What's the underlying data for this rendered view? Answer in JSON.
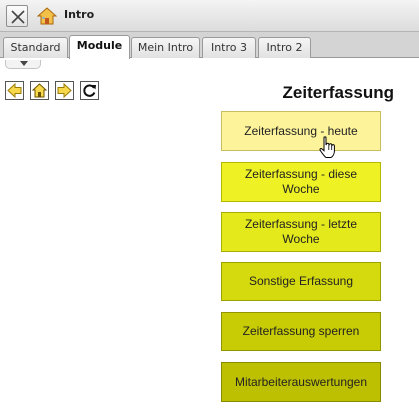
{
  "window": {
    "title": "Intro"
  },
  "tabs": [
    {
      "label": "Standard",
      "active": false
    },
    {
      "label": "Module",
      "active": true
    },
    {
      "label": "Mein Intro",
      "active": false
    },
    {
      "label": "Intro 3",
      "active": false
    },
    {
      "label": "Intro 2",
      "active": false
    }
  ],
  "toolbar": {
    "icons": [
      "arrow-left-icon",
      "home-icon",
      "arrow-right-icon",
      "refresh-icon"
    ]
  },
  "main": {
    "heading": "Zeiterfassung",
    "buttons": [
      {
        "label": "Zeiterfassung - heute",
        "color": "#fdf39a",
        "border": "#c9bd60"
      },
      {
        "label": "Zeiterfassung - diese Woche",
        "color": "#eef224",
        "border": "#b6b800"
      },
      {
        "label": "Zeiterfassung - letzte Woche",
        "color": "#e3e91b",
        "border": "#aaae00"
      },
      {
        "label": "Sonstige Erfassung",
        "color": "#d5da0e",
        "border": "#9ea200"
      },
      {
        "label": "Zeiterfassung sperren",
        "color": "#c8cc04",
        "border": "#939500"
      },
      {
        "label": "Mitarbeiterauswertungen",
        "color": "#bdc000",
        "border": "#888a00"
      }
    ]
  },
  "colors": {
    "accent": "#d5da0e"
  }
}
